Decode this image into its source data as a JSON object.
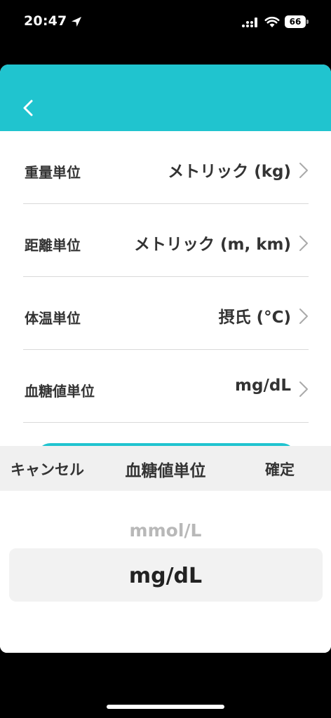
{
  "status_bar": {
    "time": "20:47",
    "battery": "66"
  },
  "nav": {
    "back_icon": "chevron-left-icon",
    "color": "#20c4cf"
  },
  "settings": [
    {
      "label": "重量単位",
      "value": "メトリック (kg)"
    },
    {
      "label": "距離単位",
      "value": "メトリック (m, km)"
    },
    {
      "label": "体温単位",
      "value": "摂氏 (°C)"
    },
    {
      "label": "血糖値単位",
      "value": "mg/dL"
    }
  ],
  "picker": {
    "cancel_label": "キャンセル",
    "title": "血糖値単位",
    "confirm_label": "確定",
    "options": [
      "mmol/L",
      "mg/dL"
    ],
    "selected": "mg/dL"
  }
}
